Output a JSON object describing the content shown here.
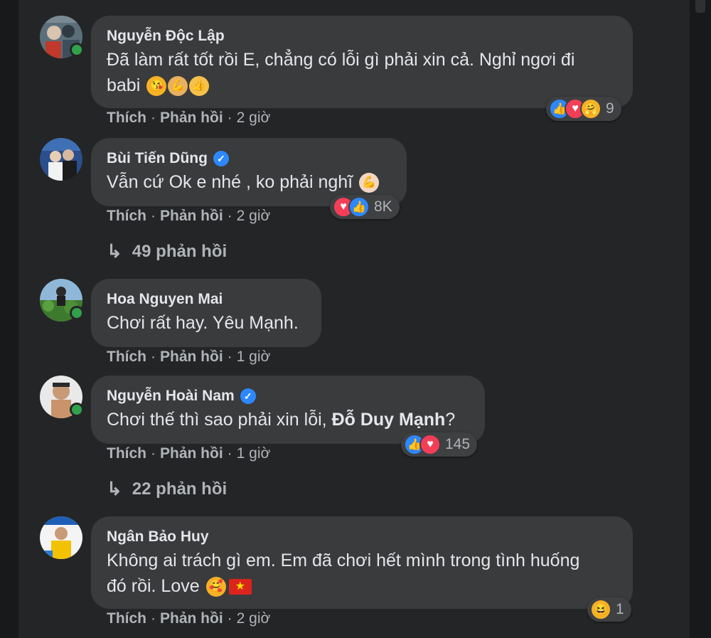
{
  "comments": [
    {
      "author": "Nguyễn Độc Lập",
      "verified": false,
      "online": true,
      "text_line1": "Đã làm rất tốt rồi E, chẳng có lỗi gì phải xin cả. Nghỉ ngơi đi",
      "text_line2": "babi",
      "emojis": [
        "kiss-face",
        "flexed-biceps",
        "thumbs-up"
      ],
      "like": "Thích",
      "reply": "Phản hồi",
      "time": "2 giờ",
      "reactions": [
        "like",
        "love",
        "care"
      ],
      "reaction_count": "9"
    },
    {
      "author": "Bùi Tiến Dũng",
      "verified": true,
      "online": false,
      "text_line1": "Vẫn cứ Ok e nhé , ko phải nghĩ",
      "emojis": [
        "flexed-biceps"
      ],
      "like": "Thích",
      "reply": "Phản hồi",
      "time": "2 giờ",
      "reactions": [
        "love",
        "like"
      ],
      "reaction_count": "8K",
      "replies": "49 phản hồi"
    },
    {
      "author": "Hoa Nguyen Mai",
      "verified": false,
      "online": true,
      "text_line1": "Chơi rất hay. Yêu Mạnh.",
      "like": "Thích",
      "reply": "Phản hồi",
      "time": "1 giờ"
    },
    {
      "author": "Nguyễn Hoài Nam",
      "verified": true,
      "online": true,
      "text_prefix": "Chơi thế thì sao phải xin lỗi, ",
      "mention": "Đỗ Duy Mạnh",
      "text_suffix": "?",
      "like": "Thích",
      "reply": "Phản hồi",
      "time": "1 giờ",
      "reactions": [
        "like",
        "love"
      ],
      "reaction_count": "145",
      "replies": "22 phản hồi"
    },
    {
      "author": "Ngân Bảo Huy",
      "verified": false,
      "online": false,
      "text_line1": "Không ai trách gì em. Em đã chơi hết mình trong tình huống",
      "text_line2": "đó rồi. Love",
      "emojis": [
        "smiling-face-with-hearts",
        "vietnam-flag"
      ],
      "like": "Thích",
      "reply": "Phản hồi",
      "time": "2 giờ",
      "reactions": [
        "haha"
      ],
      "reaction_count": "1"
    }
  ],
  "colors": {
    "background": "#242526",
    "bubble": "#3a3b3c",
    "text": "#e4e6eb",
    "secondary": "#b0b3b8",
    "online": "#31a24c",
    "like": "#2d88ff",
    "love": "#f33e58"
  }
}
